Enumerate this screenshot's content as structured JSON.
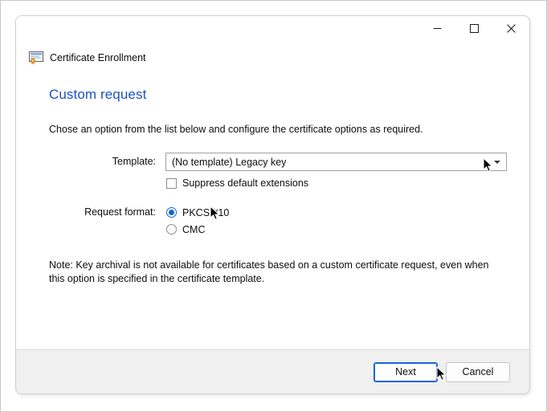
{
  "window": {
    "app_title": "Certificate Enrollment",
    "app_icon": "certificate-icon",
    "controls": {
      "minimize": "minimize-icon",
      "maximize": "maximize-icon",
      "close": "close-icon"
    }
  },
  "page": {
    "heading": "Custom request",
    "intro": "Chose an option from the list below and configure the certificate options as required.",
    "note": "Note: Key archival is not available for certificates based on a custom certificate request, even when this option is specified in the certificate template."
  },
  "form": {
    "template": {
      "label": "Template:",
      "value": "(No template) Legacy key",
      "arrow_icon": "chevron-down-icon"
    },
    "suppress_extensions": {
      "label": "Suppress default extensions",
      "checked": false
    },
    "request_format": {
      "label": "Request format:",
      "options": [
        {
          "label": "PKCS #10",
          "selected": true
        },
        {
          "label": "CMC",
          "selected": false
        }
      ]
    }
  },
  "footer": {
    "next_label": "Next",
    "cancel_label": "Cancel"
  },
  "colors": {
    "heading_blue": "#1b52c0",
    "accent_blue": "#1565d8",
    "footer_bg": "#f0f0f0",
    "border": "#cfcfcf"
  }
}
